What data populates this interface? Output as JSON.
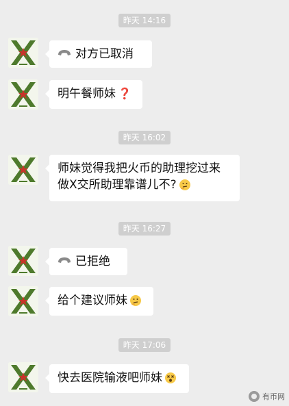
{
  "messages": {
    "t1": "昨天 14:16",
    "m1": "对方已取消",
    "m2": "明午餐师妹",
    "m2_emoji": "❓",
    "t2": "昨天 16:02",
    "m3_line1": "师妹觉得我把火币的助理挖过来",
    "m3_line2": "做X交所助理靠谱儿不?",
    "t3": "昨天 16:27",
    "m4": "已拒绝",
    "m5": "给个建议师妹",
    "t4": "昨天 17:06",
    "m6": "快去医院输液吧师妹"
  },
  "watermark": {
    "label": "有币网"
  },
  "colors": {
    "background": "#ededed",
    "bubble": "#ffffff",
    "timestamp_bg": "#cfcfcf",
    "avatar_green": "#4e7a2c",
    "avatar_red": "#c8342a"
  },
  "icons": {
    "call": "phone-hangup-icon",
    "question": "red-question-icon",
    "thinking": "thinking-emoji-icon",
    "dizzy": "dizzy-face-emoji-icon"
  }
}
